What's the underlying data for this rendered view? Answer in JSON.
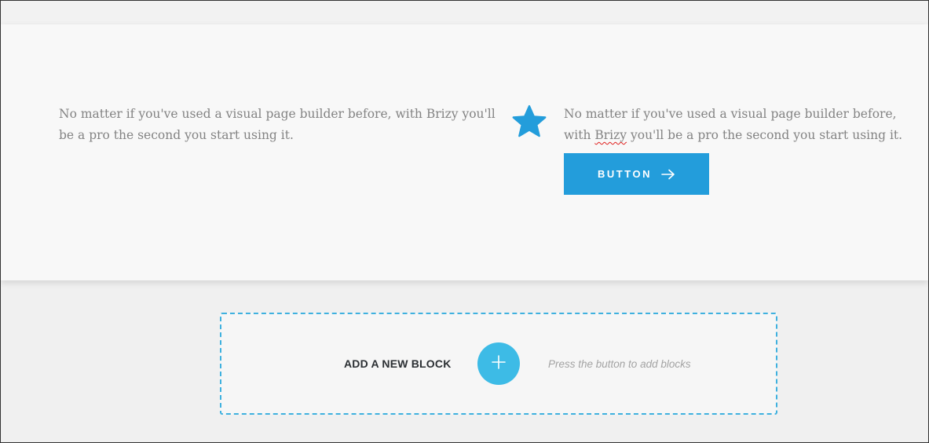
{
  "section": {
    "left_text": "No matter if you've used a visual page builder before, with Brizy you'll be a pro the second you start using it.",
    "right_text_prefix": "No matter if you've used a visual page builder before, with ",
    "right_text_flagged_word": "Brizy",
    "right_text_suffix": " you'll be a pro the second you start using it.",
    "star_icon": "star-icon",
    "button_label": "BUTTON",
    "button_icon": "arrow-right-icon"
  },
  "add_block": {
    "label": "ADD A NEW BLOCK",
    "plus_icon": "plus-icon",
    "hint": "Press the button to add blocks"
  },
  "colors": {
    "accent_blue": "#239ddb",
    "plus_circle": "#3dbbe6",
    "dashed_border": "#3fb1df",
    "body_text": "#838383",
    "spellcheck_underline": "#e0201e"
  }
}
